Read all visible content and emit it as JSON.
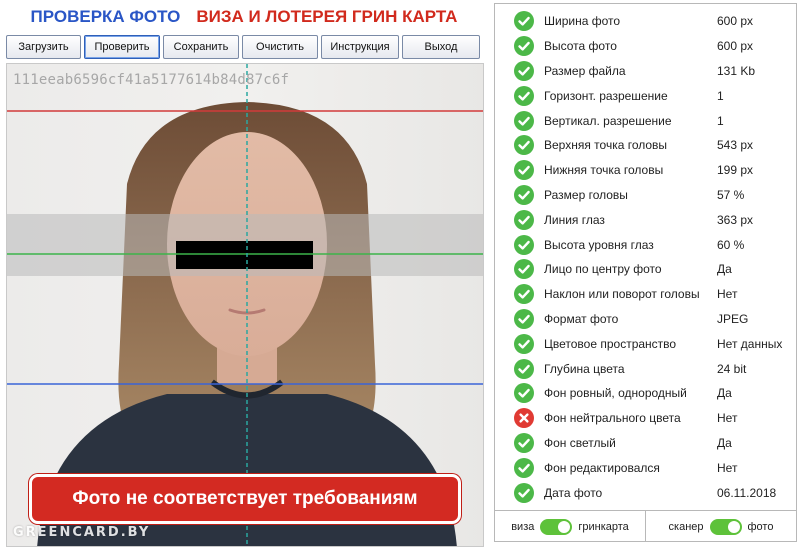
{
  "header": {
    "title_left": "ПРОВЕРКА ФОТО",
    "title_right": "ВИЗА И ЛОТЕРЕЯ ГРИН КАРТА"
  },
  "toolbar": {
    "buttons": [
      {
        "label": "Загрузить"
      },
      {
        "label": "Проверить"
      },
      {
        "label": "Сохранить"
      },
      {
        "label": "Очистить"
      },
      {
        "label": "Инструкция"
      },
      {
        "label": "Выход"
      }
    ]
  },
  "photo": {
    "hash": "111eeab6596cf41a5177614b84d87c6f",
    "warning": "Фото не соответствует требованиям",
    "watermark": "GREENCARD.BY"
  },
  "checks": [
    {
      "label": "Ширина фото",
      "value": "600 px",
      "status": "ok"
    },
    {
      "label": "Высота фото",
      "value": "600 px",
      "status": "ok"
    },
    {
      "label": "Размер файла",
      "value": "131 Kb",
      "status": "ok"
    },
    {
      "label": "Горизонт. разрешение",
      "value": "1",
      "status": "ok"
    },
    {
      "label": "Вертикал. разрешение",
      "value": "1",
      "status": "ok"
    },
    {
      "label": "Верхняя точка головы",
      "value": "543 px",
      "status": "ok"
    },
    {
      "label": "Нижняя точка головы",
      "value": "199 px",
      "status": "ok"
    },
    {
      "label": "Размер головы",
      "value": "57 %",
      "status": "ok"
    },
    {
      "label": "Линия глаз",
      "value": "363 px",
      "status": "ok"
    },
    {
      "label": "Высота уровня глаз",
      "value": "60 %",
      "status": "ok"
    },
    {
      "label": "Лицо по центру фото",
      "value": "Да",
      "status": "ok"
    },
    {
      "label": "Наклон или поворот головы",
      "value": "Нет",
      "status": "ok"
    },
    {
      "label": "Формат фото",
      "value": "JPEG",
      "status": "ok"
    },
    {
      "label": "Цветовое пространство",
      "value": "Нет данных",
      "status": "ok"
    },
    {
      "label": "Глубина цвета",
      "value": "24 bit",
      "status": "ok"
    },
    {
      "label": "Фон ровный, однородный",
      "value": "Да",
      "status": "ok"
    },
    {
      "label": "Фон нейтрального цвета",
      "value": "Нет",
      "status": "fail"
    },
    {
      "label": "Фон светлый",
      "value": "Да",
      "status": "ok"
    },
    {
      "label": "Фон редактировался",
      "value": "Нет",
      "status": "ok"
    },
    {
      "label": "Дата фото",
      "value": "06.11.2018",
      "status": "ok"
    }
  ],
  "footer": {
    "toggle1": {
      "left": "виза",
      "right": "гринкарта"
    },
    "toggle2": {
      "left": "сканер",
      "right": "фото"
    }
  },
  "colors": {
    "ok": "#4cb848",
    "fail": "#e03a33",
    "title_blue": "#2a56c6",
    "title_red": "#d12a1d"
  },
  "icons": {
    "ok": "check-circle-icon",
    "fail": "cross-circle-icon"
  }
}
